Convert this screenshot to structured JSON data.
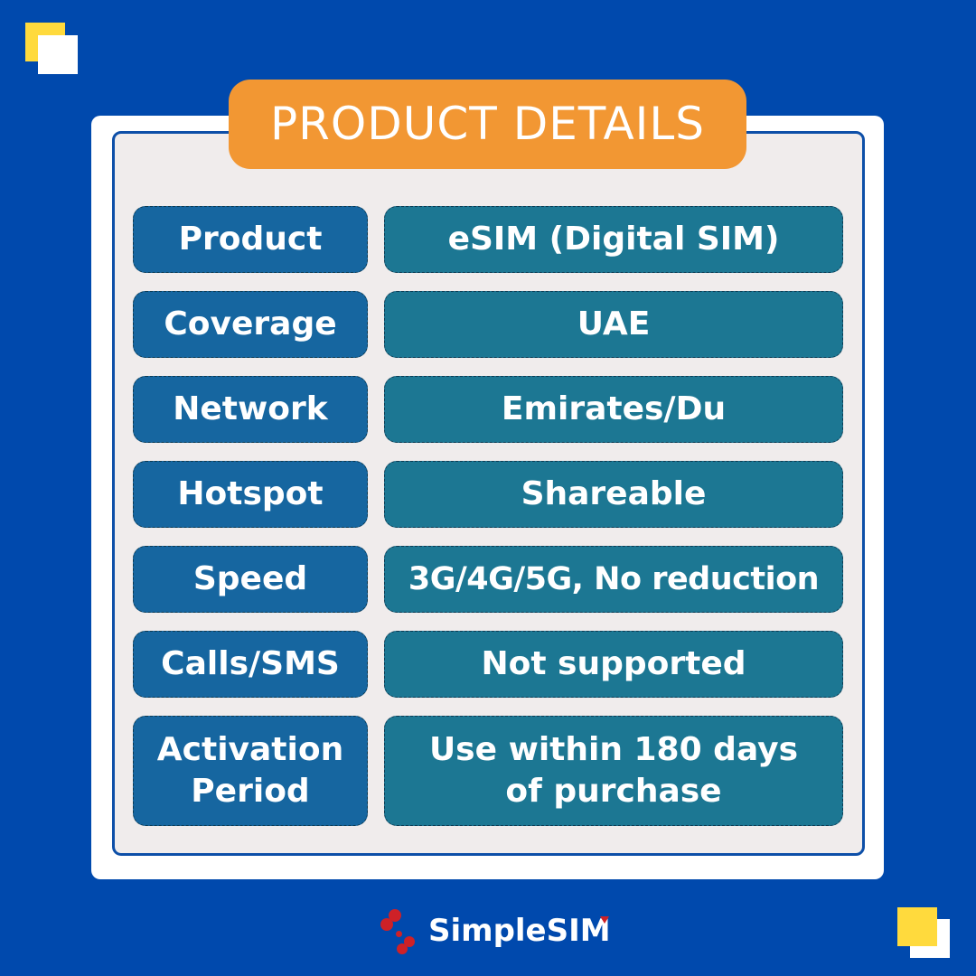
{
  "title": "PRODUCT DETAILS",
  "rows": [
    {
      "label": "Product",
      "value": "eSIM (Digital SIM)"
    },
    {
      "label": "Coverage",
      "value": "UAE"
    },
    {
      "label": "Network",
      "value": "Emirates/Du"
    },
    {
      "label": "Hotspot",
      "value": "Shareable"
    },
    {
      "label": "Speed",
      "value": "3G/4G/5G, No reduction"
    },
    {
      "label": "Calls/SMS",
      "value": "Not supported"
    },
    {
      "label_line1": "Activation",
      "label_line2": "Period",
      "value_line1": "Use within 180 days",
      "value_line2": "of purchase"
    }
  ],
  "brand": {
    "name": "SimpleSIM",
    "logo_icon": "simplesim-dots-logo-icon"
  },
  "colors": {
    "background": "#0049AD",
    "title_badge": "#F29733",
    "label_box": "#1666A0",
    "value_box": "#1C7793",
    "accent_yellow": "#FFDA3D",
    "logo_red": "#CE2127",
    "panel_inner": "#F0ECEC"
  }
}
